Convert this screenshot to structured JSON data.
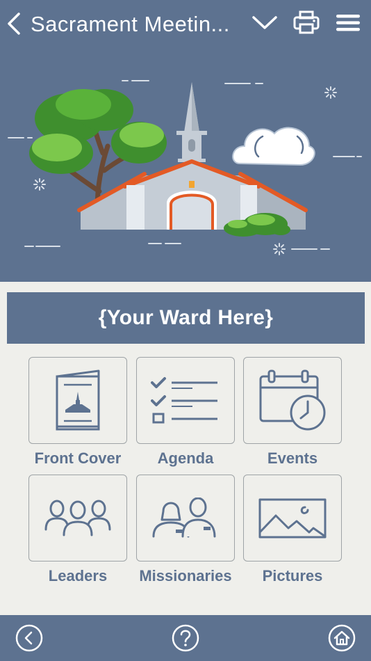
{
  "header": {
    "title": "Sacrament Meetin...",
    "icons": {
      "back": "chevron-left-icon",
      "dropdown": "chevron-down-icon",
      "print": "printer-icon",
      "menu": "hamburger-menu-icon"
    }
  },
  "hero": {
    "image": "church-illustration"
  },
  "ward": {
    "name": "{Your Ward Here}"
  },
  "tiles": [
    {
      "label": "Front Cover",
      "icon": "program-booklet-icon"
    },
    {
      "label": "Agenda",
      "icon": "checklist-icon"
    },
    {
      "label": "Events",
      "icon": "calendar-clock-icon"
    },
    {
      "label": "Leaders",
      "icon": "group-people-icon"
    },
    {
      "label": "Missionaries",
      "icon": "missionaries-icon"
    },
    {
      "label": "Pictures",
      "icon": "landscape-picture-icon"
    }
  ],
  "footer": {
    "icons": {
      "back": "circle-back-icon",
      "help": "circle-help-icon",
      "home": "circle-home-icon"
    }
  },
  "colors": {
    "primary": "#5d7290",
    "background": "#efefeb",
    "tile_border": "#9ea3a6",
    "white": "#ffffff"
  }
}
